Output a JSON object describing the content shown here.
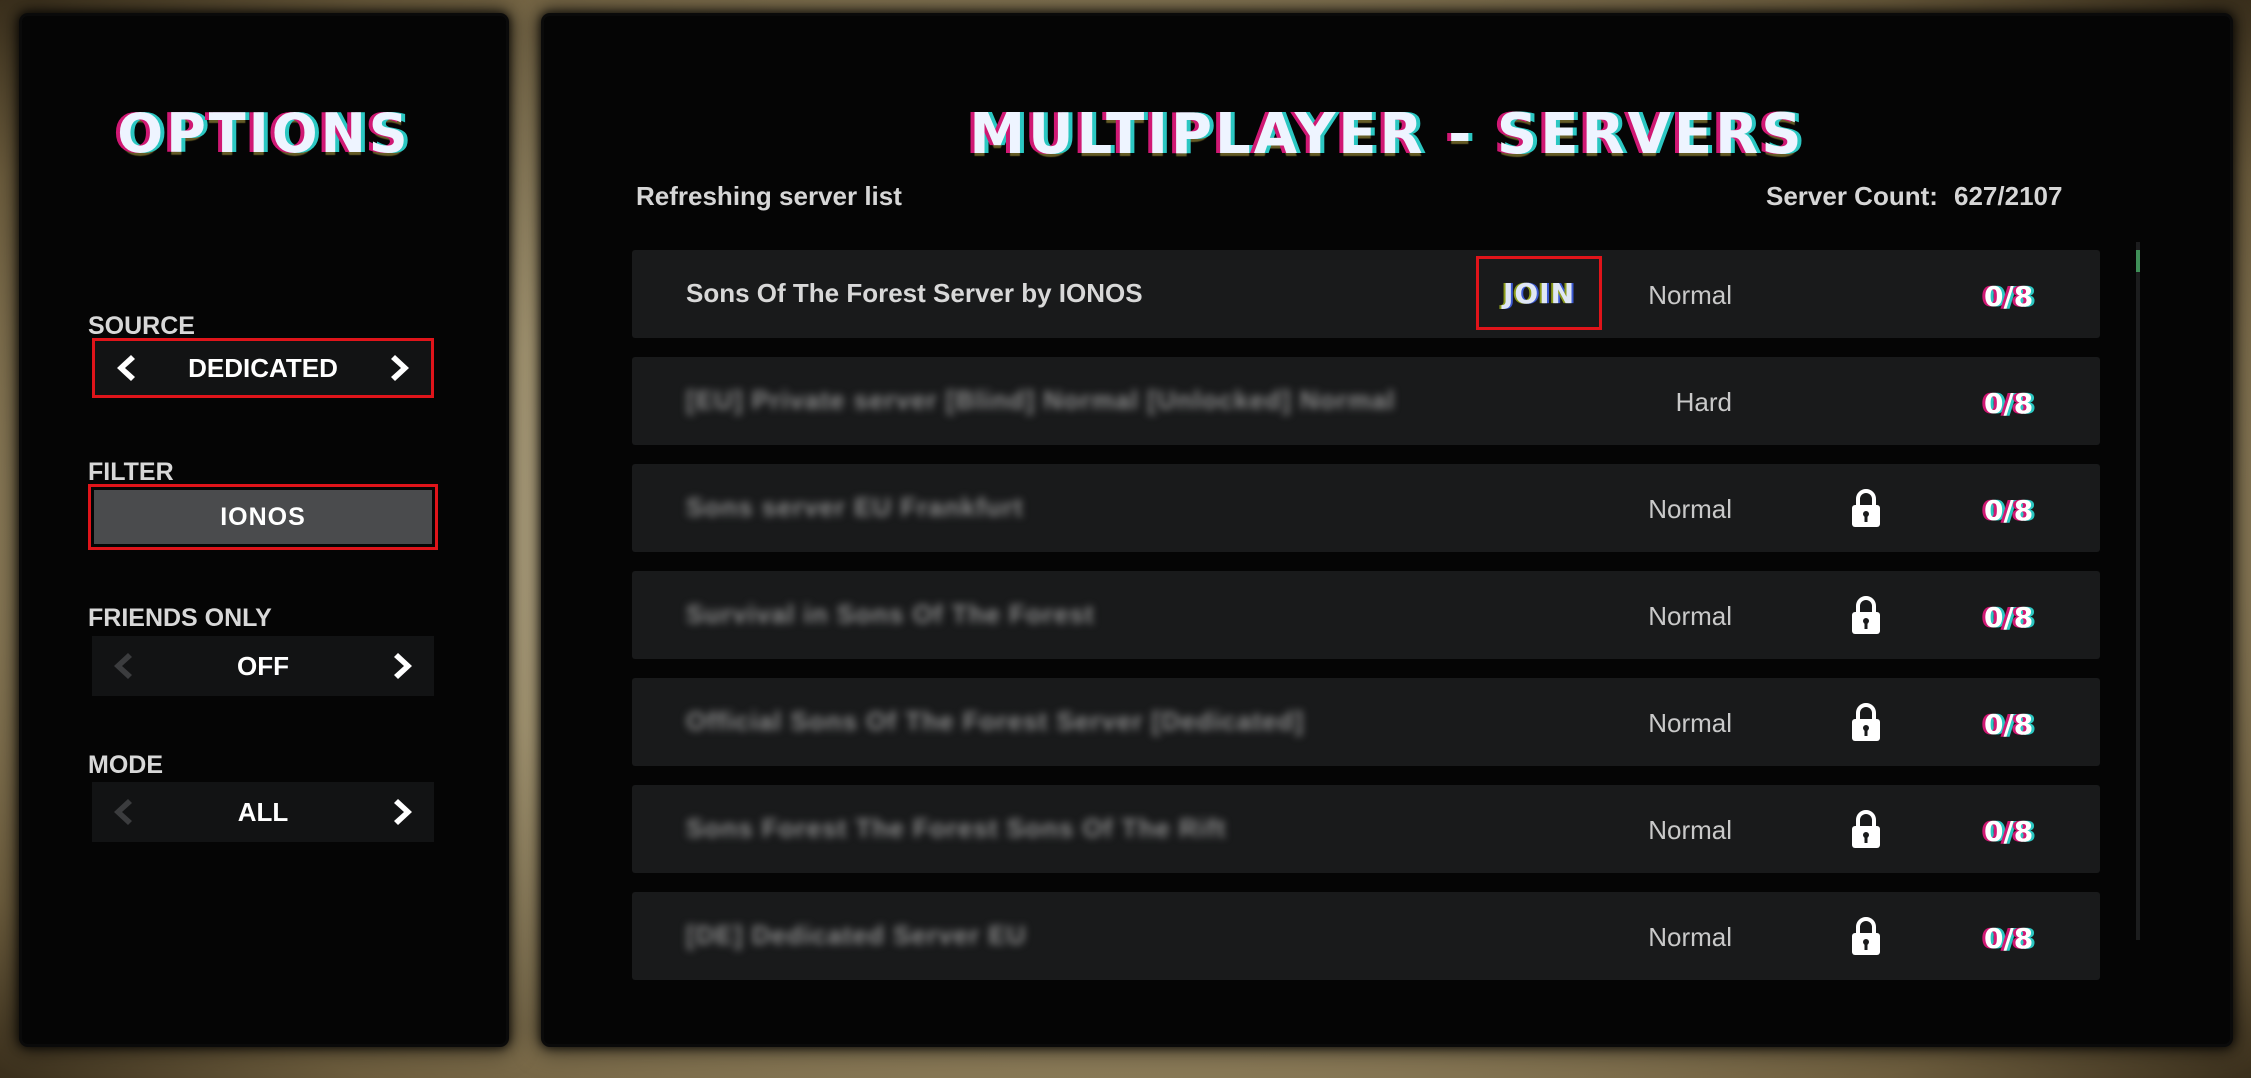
{
  "options": {
    "title": "OPTIONS",
    "source": {
      "label": "SOURCE",
      "value": "DEDICATED"
    },
    "filter": {
      "label": "FILTER",
      "value": "IONOS"
    },
    "friends_only": {
      "label": "FRIENDS ONLY",
      "value": "OFF"
    },
    "mode": {
      "label": "MODE",
      "value": "ALL"
    }
  },
  "multiplayer": {
    "title": "MULTIPLAYER - SERVERS",
    "status": "Refreshing server list",
    "server_count_label": "Server Count:",
    "server_count_value": "627/2107",
    "join_label": "JOIN",
    "servers": [
      {
        "name": "Sons Of The Forest Server by IONOS",
        "difficulty": "Normal",
        "locked": false,
        "players": "0/8"
      },
      {
        "name": "[EU] Private server [Blind] Normal [Unlocked] Normal",
        "difficulty": "Hard",
        "locked": false,
        "players": "0/8"
      },
      {
        "name": "Sons server EU Frankfurt",
        "difficulty": "Normal",
        "locked": true,
        "players": "0/8"
      },
      {
        "name": "Survival in Sons Of The Forest",
        "difficulty": "Normal",
        "locked": true,
        "players": "0/8"
      },
      {
        "name": "Official Sons Of The Forest Server [Dedicated]",
        "difficulty": "Normal",
        "locked": true,
        "players": "0/8"
      },
      {
        "name": "Sons Forest The Forest Sons Of The Rift",
        "difficulty": "Normal",
        "locked": true,
        "players": "0/8"
      },
      {
        "name": "[DE] Dedicated Server EU",
        "difficulty": "Normal",
        "locked": true,
        "players": "0/8"
      }
    ]
  }
}
